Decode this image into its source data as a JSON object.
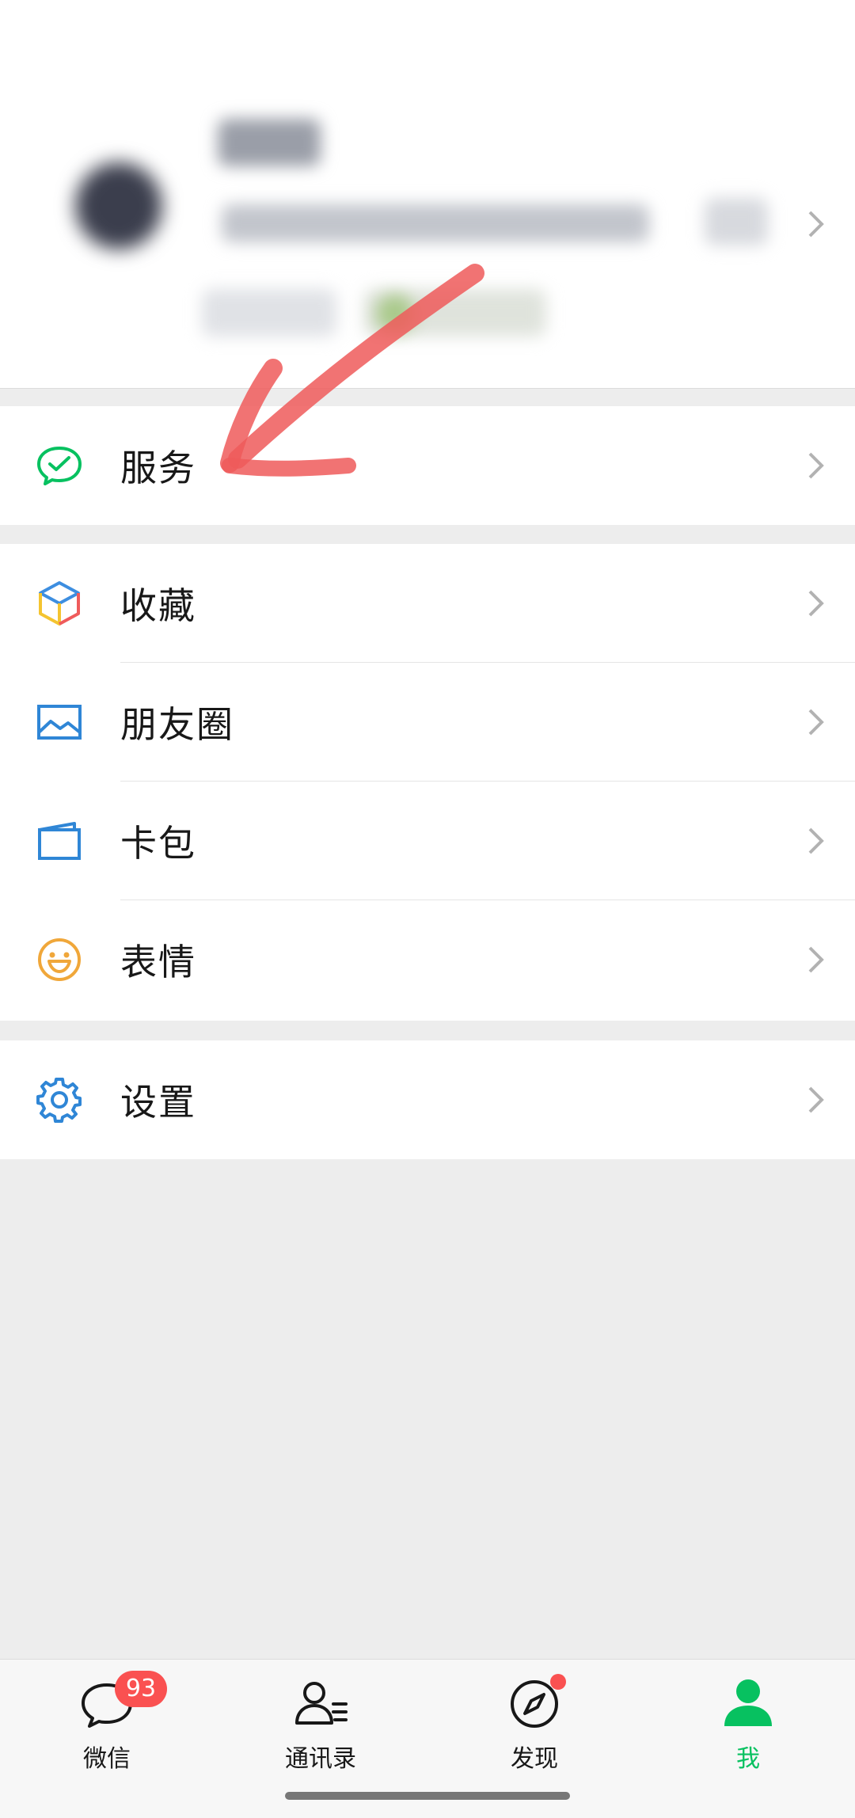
{
  "profile": {
    "chevron_icon": "chevron-right-icon"
  },
  "menu": {
    "services": {
      "label": "服务",
      "icon": "services-check-icon"
    },
    "favorites": {
      "label": "收藏",
      "icon": "favorites-cube-icon"
    },
    "moments": {
      "label": "朋友圈",
      "icon": "moments-image-icon"
    },
    "cards": {
      "label": "卡包",
      "icon": "wallet-card-icon"
    },
    "stickers": {
      "label": "表情",
      "icon": "sticker-smile-icon"
    },
    "settings": {
      "label": "设置",
      "icon": "settings-gear-icon"
    }
  },
  "tabbar": {
    "chats": {
      "label": "微信",
      "badge": "93",
      "icon": "chat-bubble-icon"
    },
    "contacts": {
      "label": "通讯录",
      "icon": "contacts-icon"
    },
    "discover": {
      "label": "发现",
      "icon": "compass-icon"
    },
    "me": {
      "label": "我",
      "icon": "person-icon"
    }
  },
  "colors": {
    "accent_green": "#07c160",
    "badge_red": "#fa5151",
    "annotation_arrow": "#ef5b5b",
    "background": "#ededed"
  }
}
